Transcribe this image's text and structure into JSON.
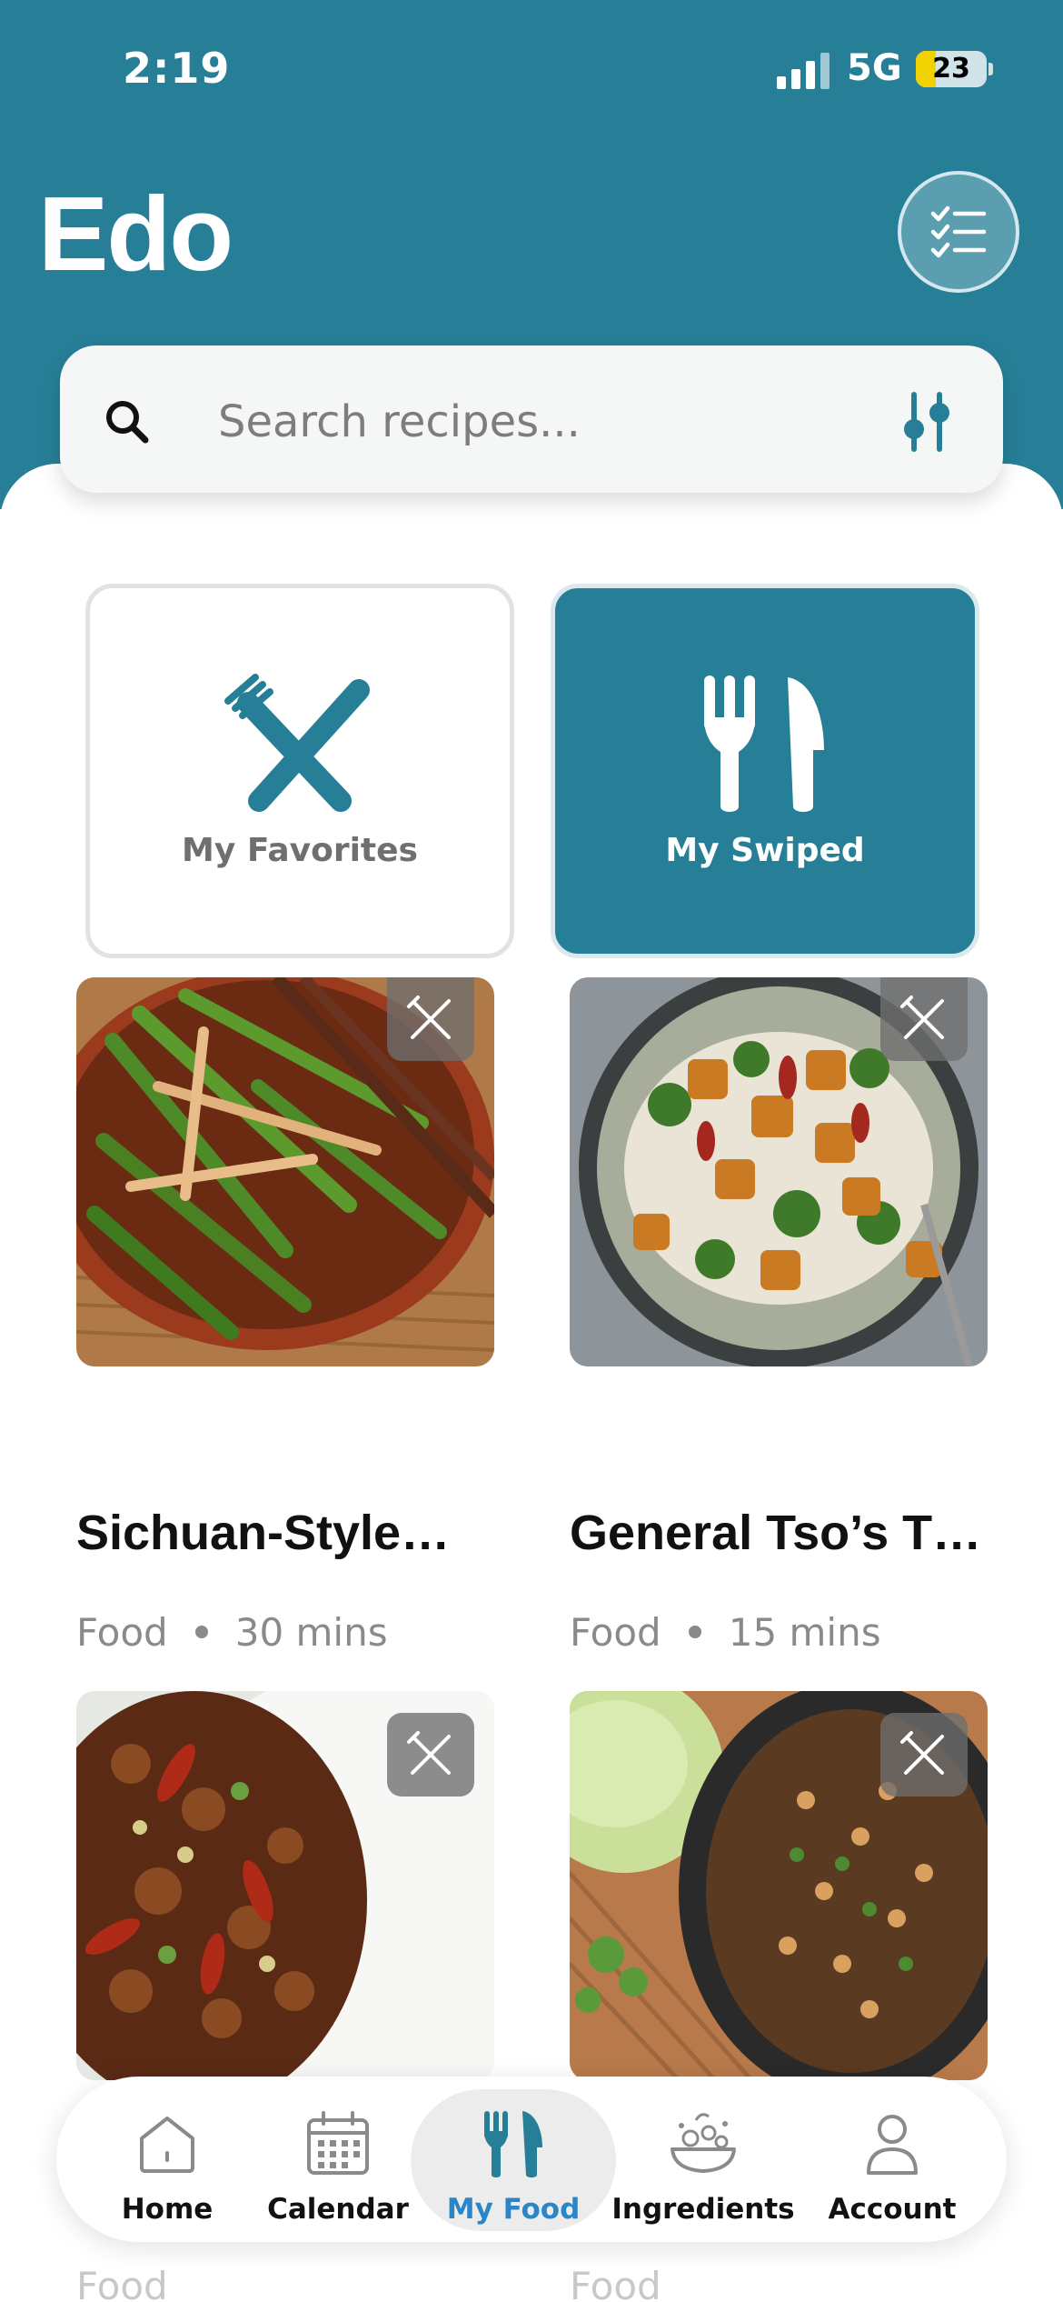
{
  "status_bar": {
    "time": "2:19",
    "network": "5G",
    "battery": "23"
  },
  "header": {
    "title": "Edo"
  },
  "search": {
    "placeholder": "Search recipes..."
  },
  "tiles": [
    {
      "label": "My Favorites",
      "selected": false
    },
    {
      "label": "My Swiped",
      "selected": true
    }
  ],
  "recipes": [
    {
      "title": "Sichuan-Style…",
      "category": "Food",
      "time": "30 mins"
    },
    {
      "title": "General Tso’s T…",
      "category": "Food",
      "time": "15 mins"
    },
    {
      "title": "",
      "category": "Food",
      "time": ""
    },
    {
      "title": "",
      "category": "Food",
      "time": ""
    }
  ],
  "tabbar": {
    "tabs": [
      {
        "label": "Home",
        "icon": "home-icon"
      },
      {
        "label": "Calendar",
        "icon": "calendar-icon"
      },
      {
        "label": "My Food",
        "icon": "fork-knife-icon",
        "active": true
      },
      {
        "label": "Ingredients",
        "icon": "ingredients-icon"
      },
      {
        "label": "Account",
        "icon": "account-icon"
      }
    ]
  },
  "colors": {
    "brand": "#267f97",
    "active_tab": "#2a86c8"
  }
}
